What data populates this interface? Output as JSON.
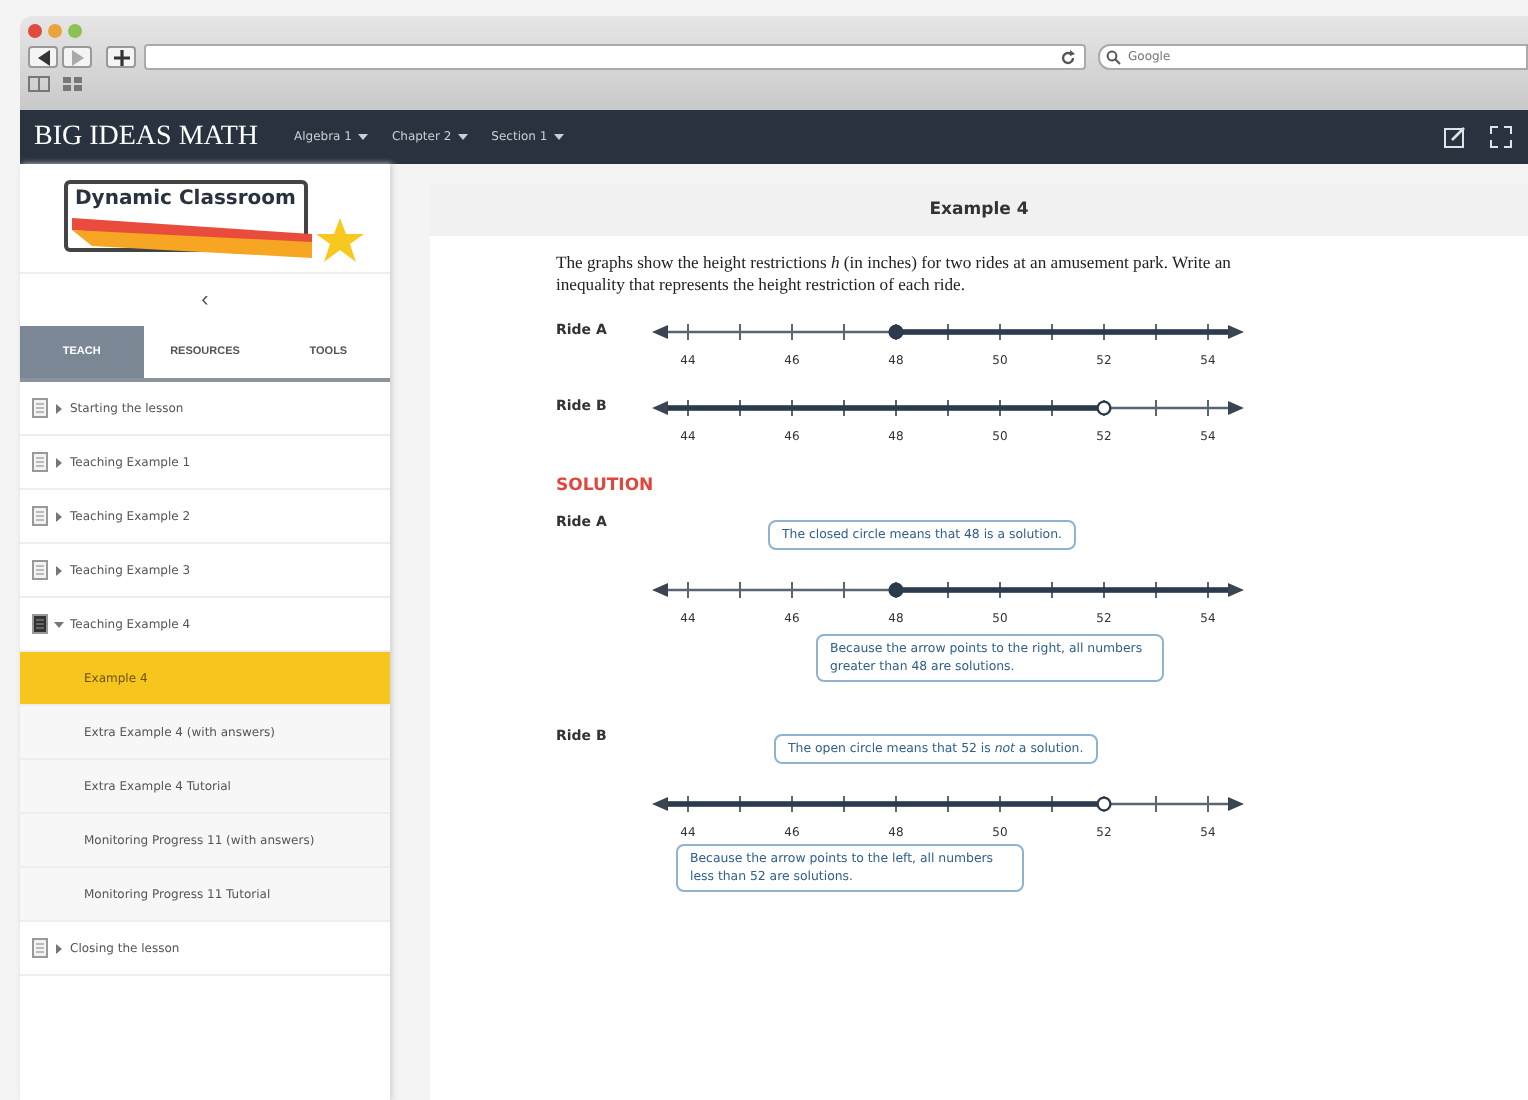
{
  "browser": {
    "search": {
      "placeholder": "Google"
    }
  },
  "navbar": {
    "brand": "BIG IDEAS MATH",
    "menus": [
      "Algebra 1",
      "Chapter 2",
      "Section 1"
    ]
  },
  "sidebar": {
    "logo": "Dynamic Classroom",
    "back": "‹",
    "tabs": [
      {
        "label": "TEACH",
        "selected": true
      },
      {
        "label": "RESOURCES",
        "selected": false
      },
      {
        "label": "TOOLS",
        "selected": false
      }
    ],
    "items": [
      {
        "label": "Starting the lesson",
        "expanded": false
      },
      {
        "label": "Teaching Example 1",
        "expanded": false
      },
      {
        "label": "Teaching Example 2",
        "expanded": false
      },
      {
        "label": "Teaching Example 3",
        "expanded": false
      },
      {
        "label": "Teaching Example 4",
        "expanded": true,
        "children": [
          {
            "label": "Example 4",
            "selected": true
          },
          {
            "label": "Extra Example 4 (with answers)",
            "selected": false
          },
          {
            "label": "Extra Example 4 Tutorial",
            "selected": false
          },
          {
            "label": "Monitoring Progress 11 (with answers)",
            "selected": false
          },
          {
            "label": "Monitoring Progress 11 Tutorial",
            "selected": false
          }
        ]
      },
      {
        "label": "Closing the lesson",
        "expanded": false
      }
    ]
  },
  "content": {
    "title": "Example 4",
    "problem": {
      "text": "The graphs show the height restrictions *h* (in inches) for two rides at an amusement park. Write an inequality that represents the height restriction of each ride.",
      "rides": [
        {
          "label": "Ride A",
          "closed": true,
          "shade_right": true,
          "ticks": [
            {
              "label": "44",
              "marked": false
            },
            {
              "label": "46",
              "marked": false
            },
            {
              "label": "48",
              "marked": true
            },
            {
              "label": "50",
              "marked": false
            },
            {
              "label": "52",
              "marked": false
            },
            {
              "label": "54",
              "marked": false
            }
          ]
        },
        {
          "label": "Ride B",
          "closed": false,
          "shade_right": false,
          "ticks": [
            {
              "label": "44",
              "marked": false
            },
            {
              "label": "46",
              "marked": false
            },
            {
              "label": "48",
              "marked": false
            },
            {
              "label": "50",
              "marked": false
            },
            {
              "label": "52",
              "marked": true
            },
            {
              "label": "54",
              "marked": false
            }
          ]
        }
      ]
    },
    "solution": {
      "heading": "SOLUTION",
      "rides": [
        {
          "label": "Ride A",
          "top_callout": "The closed circle means that 48 is a solution.",
          "bottom_callout": "Because the arrow points to the right, all numbers greater than 48 are solutions.",
          "closed": true,
          "shade_right": true,
          "ticks": [
            {
              "label": "44",
              "marked": false
            },
            {
              "label": "46",
              "marked": false
            },
            {
              "label": "48",
              "marked": true
            },
            {
              "label": "50",
              "marked": false
            },
            {
              "label": "52",
              "marked": false
            },
            {
              "label": "54",
              "marked": false
            }
          ]
        },
        {
          "label": "Ride B",
          "top_callout": "The open circle means that 52 is *not* a solution.",
          "bottom_callout": "Because the arrow points to the left, all numbers less than 52 are solutions.",
          "closed": false,
          "shade_right": false,
          "ticks": [
            {
              "label": "44",
              "marked": false
            },
            {
              "label": "46",
              "marked": false
            },
            {
              "label": "48",
              "marked": false
            },
            {
              "label": "50",
              "marked": false
            },
            {
              "label": "52",
              "marked": true
            },
            {
              "label": "54",
              "marked": false
            }
          ]
        }
      ]
    }
  }
}
